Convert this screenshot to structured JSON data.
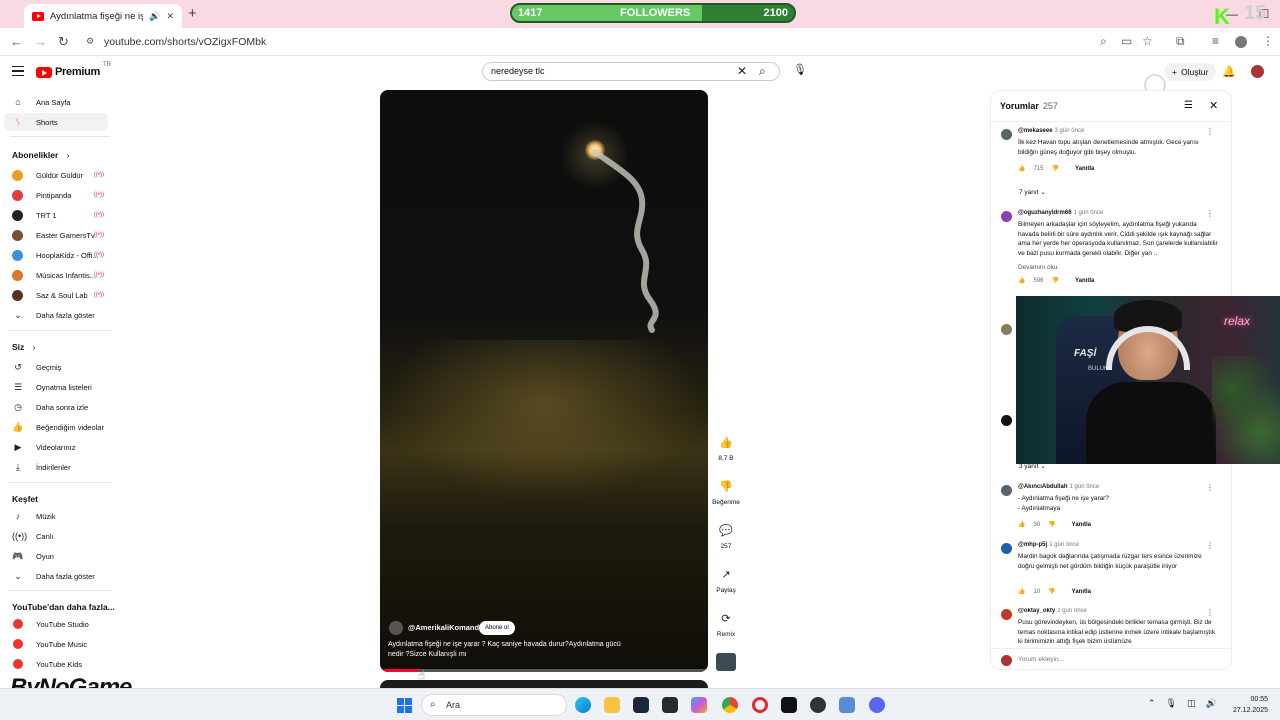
{
  "browser": {
    "tab_title": "Aydınlatma fişeği ne işe yarar",
    "url": "youtube.com/shorts/vOZigxFOMbk"
  },
  "followers_bar": {
    "current": "1417",
    "label": "FOLLOWERS",
    "goal": "2100",
    "progress": 0.675
  },
  "kick_overlay": {
    "number": "15"
  },
  "header": {
    "logo": "Premium",
    "logo_country": "TR",
    "search_value": "neredeyse  tlc",
    "create_label": "Oluştur"
  },
  "sidebar": {
    "main": [
      {
        "label": "Ana Sayfa",
        "icon": "home-icon"
      },
      {
        "label": "Shorts",
        "icon": "shorts-icon"
      }
    ],
    "subscriptions_title": "Abonelikler",
    "subscriptions": [
      {
        "label": "Güldür Güldür",
        "color": "#e8a020"
      },
      {
        "label": "Pintipanda",
        "color": "#e03c3c"
      },
      {
        "label": "TRT 1",
        "color": "#222222"
      },
      {
        "label": "Easter GamersTv",
        "color": "#7a5230"
      },
      {
        "label": "HooplaKidz - Offi...",
        "color": "#3d8fd9"
      },
      {
        "label": "Músicas Infantis...",
        "color": "#d9772b"
      },
      {
        "label": "Saz & Soul Lab",
        "color": "#553322"
      }
    ],
    "show_more": "Daha fazla göster",
    "you_title": "Siz",
    "you": [
      {
        "label": "Geçmiş",
        "icon": "history-icon"
      },
      {
        "label": "Oynatma listeleri",
        "icon": "playlist-icon"
      },
      {
        "label": "Daha sonra izle",
        "icon": "clock-icon"
      },
      {
        "label": "Beğendiğim videolar",
        "icon": "like-icon"
      },
      {
        "label": "Videolarınız",
        "icon": "video-icon"
      },
      {
        "label": "İndirilenler",
        "icon": "download-icon"
      }
    ],
    "explore_title": "Keşfet",
    "explore": [
      {
        "label": "Müzik",
        "icon": "music-icon"
      },
      {
        "label": "Canlı",
        "icon": "live-icon"
      },
      {
        "label": "Oyun",
        "icon": "gamepad-icon"
      }
    ],
    "show_more_2": "Daha fazla göster",
    "more_title": "YouTube'dan daha fazla...",
    "more": [
      {
        "label": "YouTube Studio"
      },
      {
        "label": "YouTube Music"
      },
      {
        "label": "YouTube Kids"
      }
    ]
  },
  "video": {
    "channel": "@AmerikaliKomando",
    "subscribe_label": "Abone ol",
    "title": "Aydınlatma fişeği ne işe yarar ? Kaç saniye havada durur?Aydınlatma gücü nedir ?Sizce Kullanışlı mı",
    "progress": 0.12
  },
  "actions": {
    "likes": "8,7 B",
    "dislike_label": "Beğenme",
    "comments": "257",
    "share_label": "Paylaş",
    "remix_label": "Remix"
  },
  "comments": {
    "title": "Yorumlar",
    "count": "257",
    "input_placeholder": "Yorum ekleyin...",
    "reply_label": "Yanıtla",
    "items": [
      {
        "user": "@mekaseee",
        "time": "3 gün önce",
        "text": "İlk kez Havan topu atışları denetlemesinde atmıştık. Gece yarısı bildiğin güneş doğuyor gibi bişey olmuştu.",
        "likes": "715",
        "replies": "7 yanıt",
        "color": "#556b5a"
      },
      {
        "user": "@oguzhanyldrm66",
        "time": "1 gün önce",
        "text": "Bilmeyen arkadaşlar için söyleyelim, aydınlatma fişeği yukarıda havada  belirli bir süre aydınlık verir, Ciddi şekilde ışık kaynağı sağlar ama her yerde her operasyoda kullanılmaz. Son çarelerde kullanılabilir ve bazi pusu kurmada gerekli olabilir. Diğer yan ..",
        "read_more": "Devamını oku",
        "likes": "596",
        "color": "#8e3fb0"
      },
      {
        "user": "",
        "time": "",
        "replies": "3 yanıt",
        "color": "#111111"
      },
      {
        "user": "@AkıncıAbdullah",
        "time": "1 gün önce",
        "text": "- Aydınlatma fişeği ne işe yarar?\n- Aydınlatmaya",
        "likes": "30",
        "color": "#5a6470"
      },
      {
        "user": "@mhp-p5j",
        "time": "1 gün önce",
        "text": "Mardin bagok dağlarında çatışmada rüzgar ters esince üzerimize doğru gelmişti net gördüm bildiğin küçük paraşütle iniyor",
        "likes": "10",
        "color": "#1f5fa8"
      },
      {
        "user": "@oktay_okty",
        "time": "2 gün önce",
        "text": "Pusu görevindeyken, üs bölgesindeki birlikler temasa girmişti. Biz de temas noktasına intikal edip üstlerine inmek üzere intikale başlamıştık ki birimimizin attığı fişek bizim üstümüze",
        "color": "#c0392b"
      }
    ]
  },
  "webcam": {
    "chair_text": "FAŞİ",
    "chair_sub": "BULUK",
    "neon": "relax"
  },
  "taskbar": {
    "search_placeholder": "Ara",
    "time": "00:55",
    "date": "27.12.2025",
    "apps": [
      "edge-icon",
      "folder-icon",
      "steam-icon",
      "epic-icon",
      "copilot-icon",
      "chrome-icon",
      "opera-icon",
      "capcut-icon",
      "app-icon",
      "tool-icon",
      "discord-icon"
    ]
  },
  "watermark": "ByNoGame"
}
